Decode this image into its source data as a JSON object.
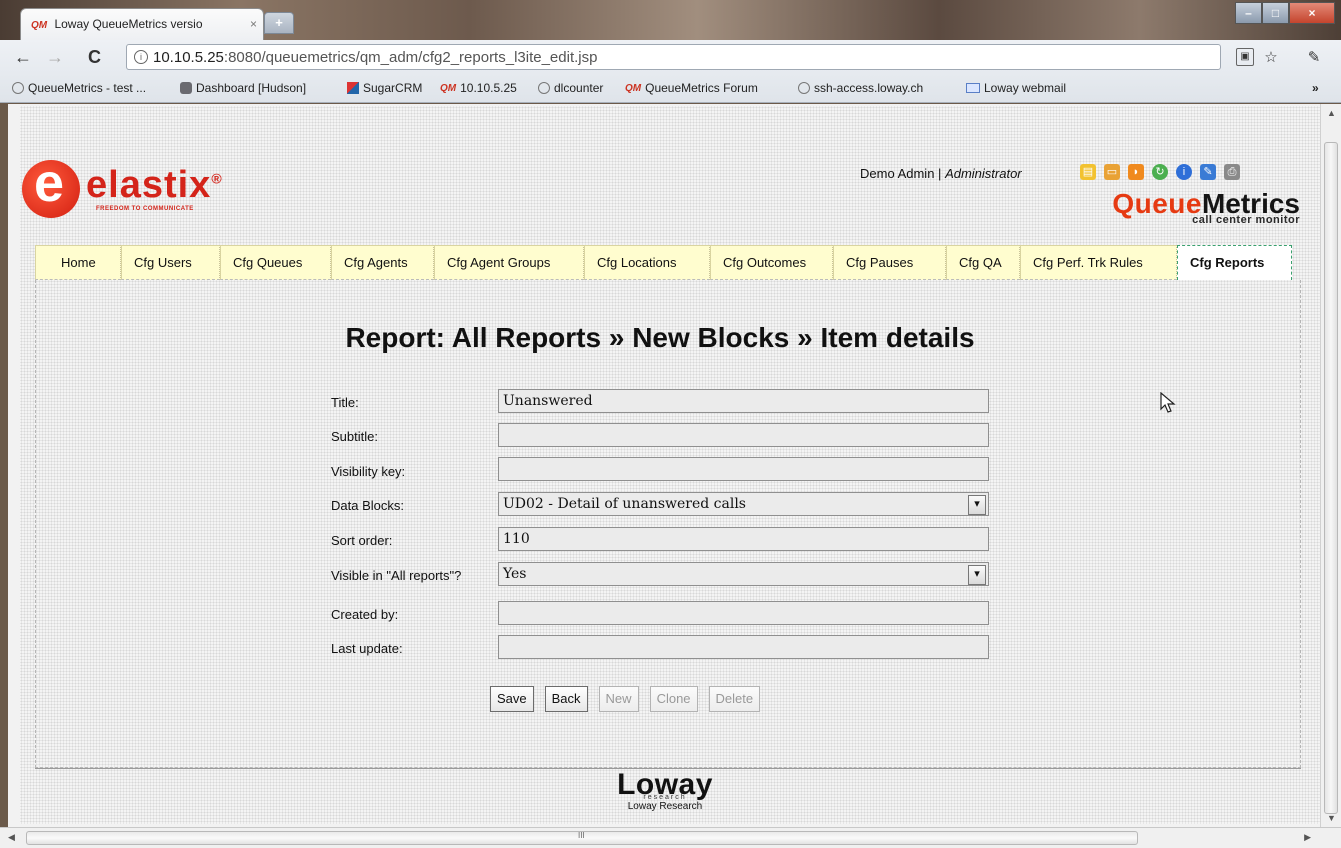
{
  "browser": {
    "tab_title": "Loway QueueMetrics versio",
    "tab_favicon": "QM",
    "tab_close": "×",
    "new_tab": "+",
    "url_host": "10.10.5.25",
    "url_path": ":8080/queuemetrics/qm_adm/cfg2_reports_l3ite_edit.jsp",
    "bookmarks": [
      {
        "label": "QueueMetrics - test ...",
        "icon": "globe-icon"
      },
      {
        "label": "Dashboard [Hudson]",
        "icon": "person-icon"
      },
      {
        "label": "SugarCRM",
        "icon": "cube-icon"
      },
      {
        "label": "10.10.5.25",
        "icon": "qm-icon"
      },
      {
        "label": "dlcounter",
        "icon": "globe-icon"
      },
      {
        "label": "QueueMetrics Forum",
        "icon": "qm-icon"
      },
      {
        "label": "ssh-access.loway.ch",
        "icon": "globe-icon"
      },
      {
        "label": "Loway webmail",
        "icon": "envelope-icon"
      }
    ],
    "bookmarks_overflow": "»"
  },
  "header": {
    "logo_word": "elastix",
    "logo_reg": "®",
    "logo_tagline": "FREEDOM TO COMMUNICATE",
    "user_name": "Demo Admin",
    "user_separator": "|",
    "user_role": "Administrator",
    "qm_logo_queue": "Queue",
    "qm_logo_metrics": "Metrics",
    "qm_logo_sub": "call center monitor"
  },
  "tabs": [
    {
      "label": "Home"
    },
    {
      "label": "Cfg Users"
    },
    {
      "label": "Cfg Queues"
    },
    {
      "label": "Cfg Agents"
    },
    {
      "label": "Cfg Agent Groups"
    },
    {
      "label": "Cfg Locations"
    },
    {
      "label": "Cfg Outcomes"
    },
    {
      "label": "Cfg Pauses"
    },
    {
      "label": "Cfg QA"
    },
    {
      "label": "Cfg Perf. Trk Rules"
    },
    {
      "label": "Cfg Reports"
    }
  ],
  "page": {
    "title": "Report: All Reports » New Blocks » Item details"
  },
  "form": {
    "title_label": "Title:",
    "title_value": "Unanswered",
    "subtitle_label": "Subtitle:",
    "subtitle_value": "",
    "visibility_label": "Visibility key:",
    "visibility_value": "",
    "datablocks_label": "Data Blocks:",
    "datablocks_value": "UD02 - Detail of unanswered calls",
    "sort_label": "Sort order:",
    "sort_value": "110",
    "visible_label": "Visible in \"All reports\"?",
    "visible_value": "Yes",
    "created_label": "Created by:",
    "created_value": "",
    "updated_label": "Last update:",
    "updated_value": ""
  },
  "buttons": {
    "save": "Save",
    "back": "Back",
    "new": "New",
    "clone": "Clone",
    "delete": "Delete"
  },
  "footer": {
    "logo_word": "Loway",
    "logo_sub": "research",
    "caption": "Loway Research"
  },
  "colors": {
    "tab_bg": "#fffdcf",
    "active_tab_border": "#3aa06e",
    "elastix_red": "#d4241a",
    "qm_orange": "#e63a12"
  }
}
